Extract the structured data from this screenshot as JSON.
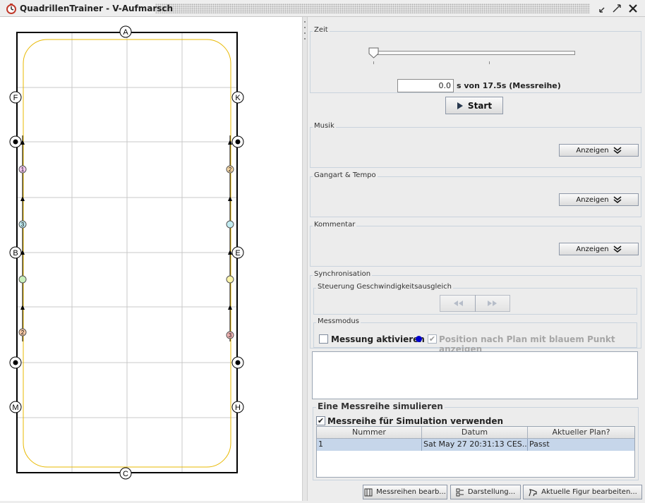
{
  "window": {
    "title": "QuadrillenTrainer - V-Aufmarsch"
  },
  "arena": {
    "markers": {
      "top": "A",
      "bottom": "C",
      "left_upper": "F",
      "right_upper": "K",
      "left_mid": "B",
      "right_mid": "E",
      "left_lower": "M",
      "right_lower": "H"
    },
    "riders_left": [
      "1",
      "3",
      "",
      "2"
    ],
    "riders_right": [
      "2",
      "",
      "",
      "3"
    ],
    "rider_colors_left": [
      "#f3c9f1",
      "#bfe9ef",
      "#c9f0bd",
      "#f6c9a7"
    ],
    "rider_colors_right": [
      "#f9d9a6",
      "#c2ecf2",
      "#fbf4a9",
      "#f4b6b6"
    ]
  },
  "zeit": {
    "label": "Zeit",
    "value": "0.0",
    "suffix": "s von 17.5s (Messreihe)",
    "start_label": "Start"
  },
  "musik": {
    "label": "Musik",
    "button": "Anzeigen"
  },
  "gangart": {
    "label": "Gangart & Tempo",
    "button": "Anzeigen"
  },
  "kommentar": {
    "label": "Kommentar",
    "button": "Anzeigen"
  },
  "synchronisation": {
    "label": "Synchronisation",
    "steuerung_label": "Steuerung Geschwindigkeitsausgleich"
  },
  "messmodus": {
    "label": "Messmodus",
    "messung_label": "Messung aktivieren",
    "position_label": "Position nach Plan mit blauem Punkt  anzeigen",
    "dot_color": "#0000cc"
  },
  "simulation": {
    "label": "Eine Messreihe simulieren",
    "checkbox_label": "Messreihe für Simulation verwenden",
    "columns": [
      "Nummer",
      "Datum",
      "Aktueller Plan?"
    ],
    "rows": [
      {
        "nummer": "1",
        "datum": "Sat May 27 20:31:13 CES...",
        "plan": "Passt"
      }
    ]
  },
  "bottom_buttons": {
    "messreihen": "Messreihen bearb...",
    "darstellung": "Darstellung...",
    "figur": "Aktuelle Figur bearbeiten..."
  }
}
